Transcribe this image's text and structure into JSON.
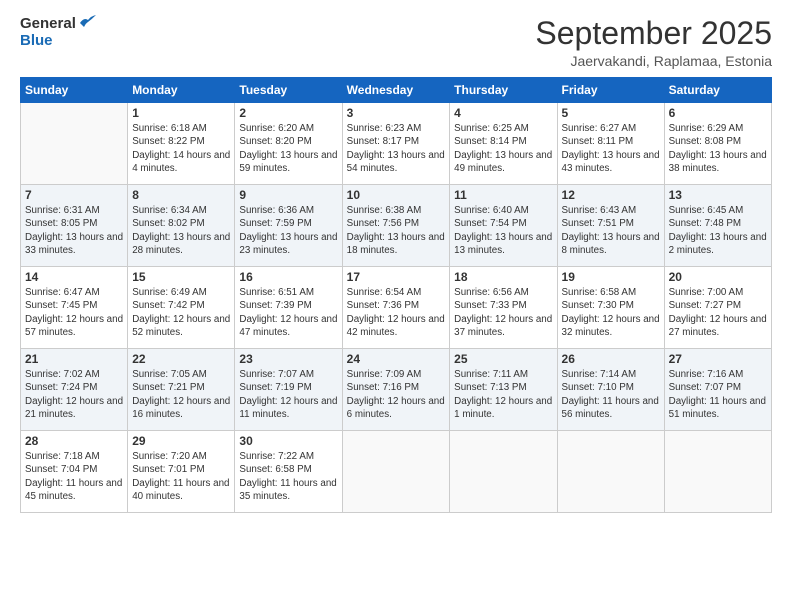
{
  "logo": {
    "line1": "General",
    "line2": "Blue"
  },
  "title": "September 2025",
  "subtitle": "Jaervakandi, Raplamaa, Estonia",
  "calendar": {
    "headers": [
      "Sunday",
      "Monday",
      "Tuesday",
      "Wednesday",
      "Thursday",
      "Friday",
      "Saturday"
    ],
    "rows": [
      [
        {
          "day": "",
          "sunrise": "",
          "sunset": "",
          "daylight": ""
        },
        {
          "day": "1",
          "sunrise": "Sunrise: 6:18 AM",
          "sunset": "Sunset: 8:22 PM",
          "daylight": "Daylight: 14 hours and 4 minutes."
        },
        {
          "day": "2",
          "sunrise": "Sunrise: 6:20 AM",
          "sunset": "Sunset: 8:20 PM",
          "daylight": "Daylight: 13 hours and 59 minutes."
        },
        {
          "day": "3",
          "sunrise": "Sunrise: 6:23 AM",
          "sunset": "Sunset: 8:17 PM",
          "daylight": "Daylight: 13 hours and 54 minutes."
        },
        {
          "day": "4",
          "sunrise": "Sunrise: 6:25 AM",
          "sunset": "Sunset: 8:14 PM",
          "daylight": "Daylight: 13 hours and 49 minutes."
        },
        {
          "day": "5",
          "sunrise": "Sunrise: 6:27 AM",
          "sunset": "Sunset: 8:11 PM",
          "daylight": "Daylight: 13 hours and 43 minutes."
        },
        {
          "day": "6",
          "sunrise": "Sunrise: 6:29 AM",
          "sunset": "Sunset: 8:08 PM",
          "daylight": "Daylight: 13 hours and 38 minutes."
        }
      ],
      [
        {
          "day": "7",
          "sunrise": "Sunrise: 6:31 AM",
          "sunset": "Sunset: 8:05 PM",
          "daylight": "Daylight: 13 hours and 33 minutes."
        },
        {
          "day": "8",
          "sunrise": "Sunrise: 6:34 AM",
          "sunset": "Sunset: 8:02 PM",
          "daylight": "Daylight: 13 hours and 28 minutes."
        },
        {
          "day": "9",
          "sunrise": "Sunrise: 6:36 AM",
          "sunset": "Sunset: 7:59 PM",
          "daylight": "Daylight: 13 hours and 23 minutes."
        },
        {
          "day": "10",
          "sunrise": "Sunrise: 6:38 AM",
          "sunset": "Sunset: 7:56 PM",
          "daylight": "Daylight: 13 hours and 18 minutes."
        },
        {
          "day": "11",
          "sunrise": "Sunrise: 6:40 AM",
          "sunset": "Sunset: 7:54 PM",
          "daylight": "Daylight: 13 hours and 13 minutes."
        },
        {
          "day": "12",
          "sunrise": "Sunrise: 6:43 AM",
          "sunset": "Sunset: 7:51 PM",
          "daylight": "Daylight: 13 hours and 8 minutes."
        },
        {
          "day": "13",
          "sunrise": "Sunrise: 6:45 AM",
          "sunset": "Sunset: 7:48 PM",
          "daylight": "Daylight: 13 hours and 2 minutes."
        }
      ],
      [
        {
          "day": "14",
          "sunrise": "Sunrise: 6:47 AM",
          "sunset": "Sunset: 7:45 PM",
          "daylight": "Daylight: 12 hours and 57 minutes."
        },
        {
          "day": "15",
          "sunrise": "Sunrise: 6:49 AM",
          "sunset": "Sunset: 7:42 PM",
          "daylight": "Daylight: 12 hours and 52 minutes."
        },
        {
          "day": "16",
          "sunrise": "Sunrise: 6:51 AM",
          "sunset": "Sunset: 7:39 PM",
          "daylight": "Daylight: 12 hours and 47 minutes."
        },
        {
          "day": "17",
          "sunrise": "Sunrise: 6:54 AM",
          "sunset": "Sunset: 7:36 PM",
          "daylight": "Daylight: 12 hours and 42 minutes."
        },
        {
          "day": "18",
          "sunrise": "Sunrise: 6:56 AM",
          "sunset": "Sunset: 7:33 PM",
          "daylight": "Daylight: 12 hours and 37 minutes."
        },
        {
          "day": "19",
          "sunrise": "Sunrise: 6:58 AM",
          "sunset": "Sunset: 7:30 PM",
          "daylight": "Daylight: 12 hours and 32 minutes."
        },
        {
          "day": "20",
          "sunrise": "Sunrise: 7:00 AM",
          "sunset": "Sunset: 7:27 PM",
          "daylight": "Daylight: 12 hours and 27 minutes."
        }
      ],
      [
        {
          "day": "21",
          "sunrise": "Sunrise: 7:02 AM",
          "sunset": "Sunset: 7:24 PM",
          "daylight": "Daylight: 12 hours and 21 minutes."
        },
        {
          "day": "22",
          "sunrise": "Sunrise: 7:05 AM",
          "sunset": "Sunset: 7:21 PM",
          "daylight": "Daylight: 12 hours and 16 minutes."
        },
        {
          "day": "23",
          "sunrise": "Sunrise: 7:07 AM",
          "sunset": "Sunset: 7:19 PM",
          "daylight": "Daylight: 12 hours and 11 minutes."
        },
        {
          "day": "24",
          "sunrise": "Sunrise: 7:09 AM",
          "sunset": "Sunset: 7:16 PM",
          "daylight": "Daylight: 12 hours and 6 minutes."
        },
        {
          "day": "25",
          "sunrise": "Sunrise: 7:11 AM",
          "sunset": "Sunset: 7:13 PM",
          "daylight": "Daylight: 12 hours and 1 minute."
        },
        {
          "day": "26",
          "sunrise": "Sunrise: 7:14 AM",
          "sunset": "Sunset: 7:10 PM",
          "daylight": "Daylight: 11 hours and 56 minutes."
        },
        {
          "day": "27",
          "sunrise": "Sunrise: 7:16 AM",
          "sunset": "Sunset: 7:07 PM",
          "daylight": "Daylight: 11 hours and 51 minutes."
        }
      ],
      [
        {
          "day": "28",
          "sunrise": "Sunrise: 7:18 AM",
          "sunset": "Sunset: 7:04 PM",
          "daylight": "Daylight: 11 hours and 45 minutes."
        },
        {
          "day": "29",
          "sunrise": "Sunrise: 7:20 AM",
          "sunset": "Sunset: 7:01 PM",
          "daylight": "Daylight: 11 hours and 40 minutes."
        },
        {
          "day": "30",
          "sunrise": "Sunrise: 7:22 AM",
          "sunset": "Sunset: 6:58 PM",
          "daylight": "Daylight: 11 hours and 35 minutes."
        },
        {
          "day": "",
          "sunrise": "",
          "sunset": "",
          "daylight": ""
        },
        {
          "day": "",
          "sunrise": "",
          "sunset": "",
          "daylight": ""
        },
        {
          "day": "",
          "sunrise": "",
          "sunset": "",
          "daylight": ""
        },
        {
          "day": "",
          "sunrise": "",
          "sunset": "",
          "daylight": ""
        }
      ]
    ]
  }
}
